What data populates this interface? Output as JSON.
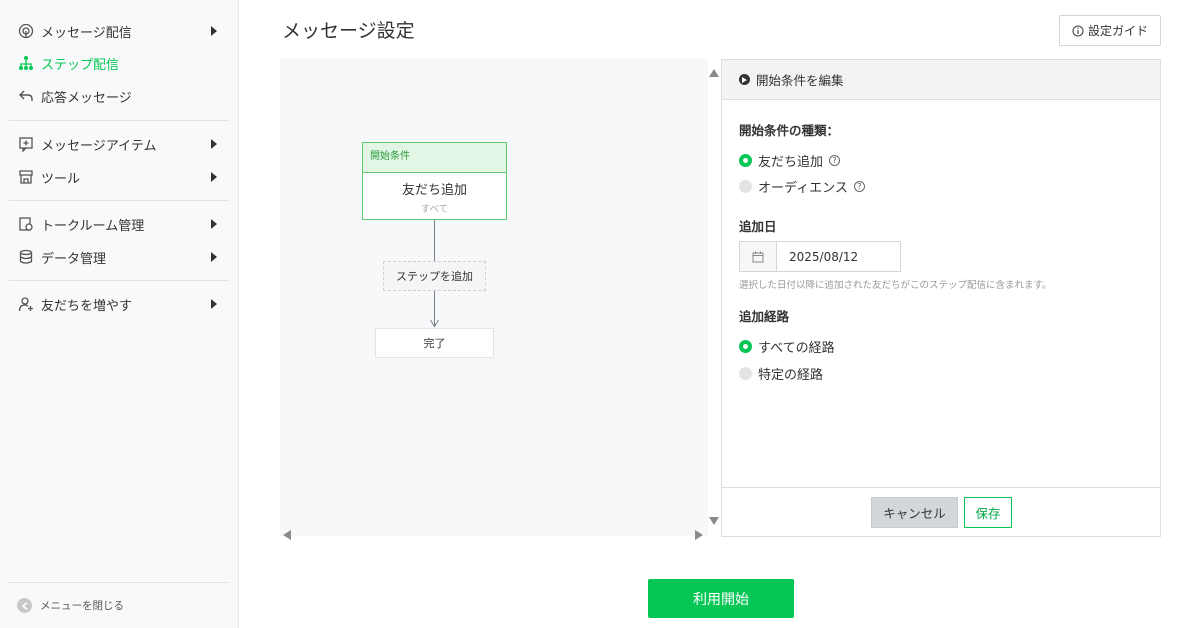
{
  "sidebar": {
    "items": [
      {
        "label": "メッセージ配信",
        "icon": "broadcast-icon",
        "has_submenu": true
      },
      {
        "label": "ステップ配信",
        "icon": "step-tree-icon",
        "active": true
      },
      {
        "label": "応答メッセージ",
        "icon": "reply-icon"
      },
      {
        "label": "メッセージアイテム",
        "icon": "add-message-icon",
        "has_submenu": true
      },
      {
        "label": "ツール",
        "icon": "store-icon",
        "has_submenu": true
      },
      {
        "label": "トークルーム管理",
        "icon": "chat-room-icon",
        "has_submenu": true
      },
      {
        "label": "データ管理",
        "icon": "database-icon",
        "has_submenu": true
      },
      {
        "label": "友だちを増やす",
        "icon": "add-friend-icon",
        "has_submenu": true
      }
    ],
    "close_menu_label": "メニューを閉じる"
  },
  "header": {
    "title": "メッセージ設定",
    "guide_button_label": "設定ガイド"
  },
  "canvas": {
    "start_node": {
      "header": "開始条件",
      "title": "友だち追加",
      "subtitle": "すべて"
    },
    "add_step_label": "ステップを追加",
    "done_label": "完了"
  },
  "panel": {
    "header": "開始条件を編集",
    "type_section": {
      "label": "開始条件の種類：",
      "options": [
        {
          "label": "友だち追加",
          "selected": true
        },
        {
          "label": "オーディエンス",
          "selected": false
        }
      ]
    },
    "date_section": {
      "label": "追加日",
      "value": "2025/08/12",
      "hint": "選択した日付以降に追加された友だちがこのステップ配信に含まれます。"
    },
    "route_section": {
      "label": "追加経路",
      "options": [
        {
          "label": "すべての経路",
          "selected": true
        },
        {
          "label": "特定の経路",
          "selected": false
        }
      ]
    },
    "cancel_label": "キャンセル",
    "save_label": "保存"
  },
  "start_button_label": "利用開始",
  "colors": {
    "accent": "#06c755",
    "sidebar_bg": "#f8f9fa",
    "canvas_bg": "#f7f8fa"
  }
}
